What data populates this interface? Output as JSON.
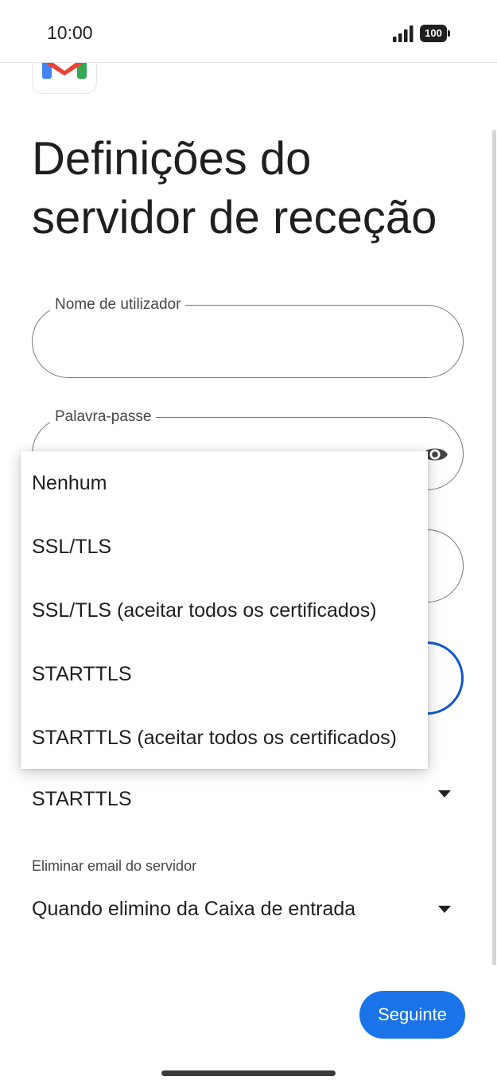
{
  "status_bar": {
    "time": "10:00",
    "battery": "100",
    "icons": [
      "signal-icon",
      "battery-icon"
    ]
  },
  "app": {
    "logo": "gmail-logo-icon"
  },
  "page": {
    "title_line1": "Definições do",
    "title_line2": "servidor de receção"
  },
  "fields": {
    "username": {
      "label": "Nome de utilizador",
      "value": ""
    },
    "password": {
      "label": "Palavra-passe",
      "value": "",
      "toggle_icon": "eye-icon"
    }
  },
  "security_select": {
    "selected": "STARTTLS",
    "options": [
      "Nenhum",
      "SSL/TLS",
      "SSL/TLS (aceitar todos os certificados)",
      "STARTTLS",
      "STARTTLS (aceitar todos os certificados)"
    ]
  },
  "delete_select": {
    "label": "Eliminar email do servidor",
    "selected": "Quando elimino da Caixa de entrada"
  },
  "actions": {
    "next_label": "Seguinte"
  },
  "colors": {
    "accent": "#1a73e8",
    "focus_border": "#0b57d0",
    "outline": "#747775",
    "text": "#1f1f1f"
  }
}
